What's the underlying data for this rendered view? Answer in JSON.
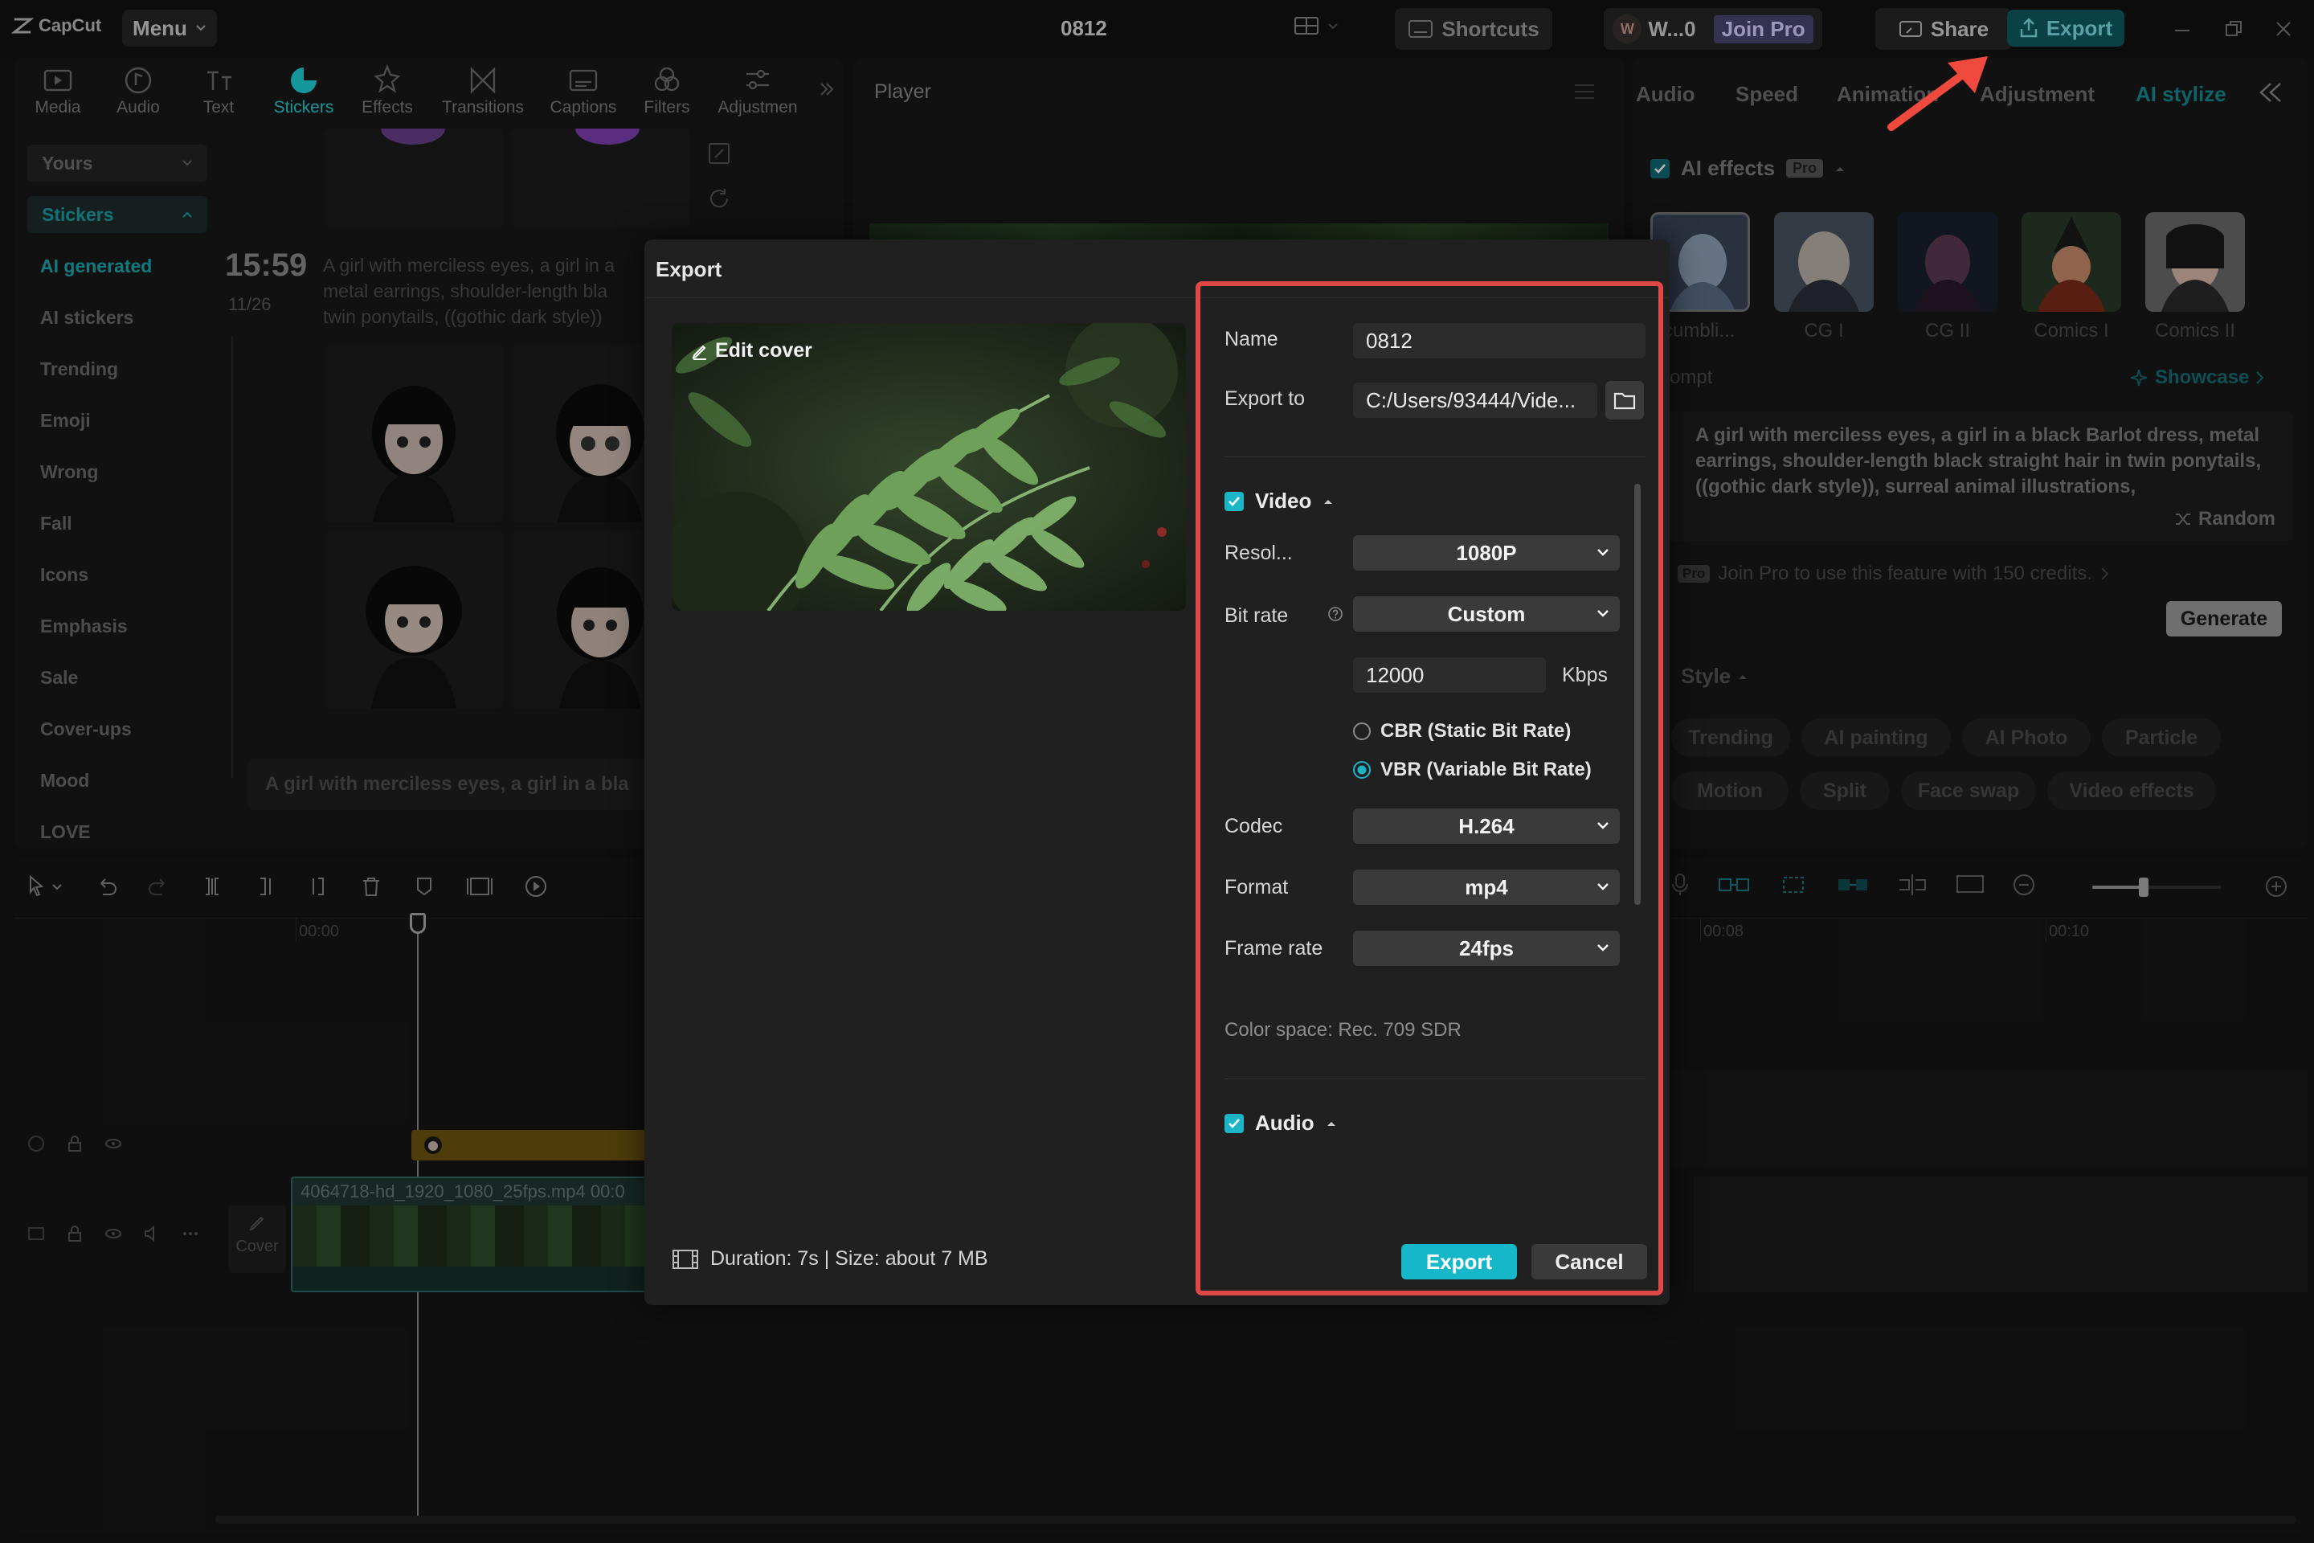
{
  "app": {
    "logo": "CapCut",
    "menu": "Menu",
    "project_name": "0812"
  },
  "topbar": {
    "shortcuts": "Shortcuts",
    "user_initial": "W",
    "user_name": "W...0",
    "join_pro": "Join Pro",
    "share": "Share",
    "export": "Export"
  },
  "tools": [
    {
      "label": "Media",
      "icon": "media-icon"
    },
    {
      "label": "Audio",
      "icon": "audio-icon"
    },
    {
      "label": "Text",
      "icon": "text-icon"
    },
    {
      "label": "Stickers",
      "icon": "stickers-icon"
    },
    {
      "label": "Effects",
      "icon": "effects-icon"
    },
    {
      "label": "Transitions",
      "icon": "transitions-icon"
    },
    {
      "label": "Captions",
      "icon": "captions-icon"
    },
    {
      "label": "Filters",
      "icon": "filters-icon"
    },
    {
      "label": "Adjustmen",
      "icon": "adjustment-icon"
    }
  ],
  "sidebar": {
    "yours": "Yours",
    "stickers": "Stickers",
    "items": [
      "AI generated",
      "AI stickers",
      "Trending",
      "Emoji",
      "Wrong",
      "Fall",
      "Icons",
      "Emphasis",
      "Sale",
      "Cover-ups",
      "Mood",
      "LOVE"
    ]
  },
  "ai_sticker": {
    "time": "15:59",
    "counter": "11/26",
    "prompt_lines": [
      "A girl with merciless eyes, a girl in a",
      "metal earrings, shoulder-length bla",
      "twin ponytails, ((gothic dark style))"
    ],
    "input_text": "A girl with merciless eyes, a girl in a bla"
  },
  "player": {
    "title": "Player"
  },
  "right_panel": {
    "tabs": [
      "Audio",
      "Speed",
      "Animation",
      "Adjustment",
      "AI stylize"
    ],
    "ai_effects": "AI effects",
    "pro_badge": "Pro",
    "styles": [
      "Scumbli...",
      "CG I",
      "CG II",
      "Comics I",
      "Comics II"
    ],
    "prompt_label": "Prompt",
    "showcase": "Showcase",
    "prompt_text": "A girl with merciless eyes, a girl in a black Barlot dress, metal earrings, shoulder-length black straight hair in twin ponytails, ((gothic dark style)), surreal animal illustrations,",
    "random": "Random",
    "join_pro_text": "Join Pro to use this feature with 150 credits.",
    "generate": "Generate",
    "style_label": "Style",
    "pills_row1": [
      "Trending",
      "AI painting",
      "AI Photo",
      "Particle"
    ],
    "pills_row2": [
      "Motion",
      "Split",
      "Face swap",
      "Video effects"
    ]
  },
  "timeline": {
    "time_start": "00:00",
    "time_8": "00:08",
    "time_10": "00:10",
    "clip_name": "4064718-hd_1920_1080_25fps.mp4  00:0",
    "cover": "Cover"
  },
  "export_dialog": {
    "title": "Export",
    "edit_cover": "Edit cover",
    "name_label": "Name",
    "name_value": "0812",
    "export_to_label": "Export to",
    "export_to_value": "C:/Users/93444/Vide...",
    "video_label": "Video",
    "resolution_label": "Resol...",
    "resolution_value": "1080P",
    "bitrate_label": "Bit rate",
    "bitrate_value": "Custom",
    "bitrate_kbps": "12000",
    "kbps_unit": "Kbps",
    "cbr": "CBR (Static Bit Rate)",
    "vbr": "VBR (Variable Bit Rate)",
    "codec_label": "Codec",
    "codec_value": "H.264",
    "format_label": "Format",
    "format_value": "mp4",
    "framerate_label": "Frame rate",
    "framerate_value": "24fps",
    "color_space": "Color space: Rec. 709 SDR",
    "audio_label": "Audio",
    "duration_size": "Duration: 7s | Size: about 7 MB",
    "export_btn": "Export",
    "cancel_btn": "Cancel"
  },
  "colors": {
    "accent": "#1ed2d9",
    "highlight_border": "#e04848",
    "arrow": "#f04a3f",
    "export_button": "#16b7c8"
  }
}
